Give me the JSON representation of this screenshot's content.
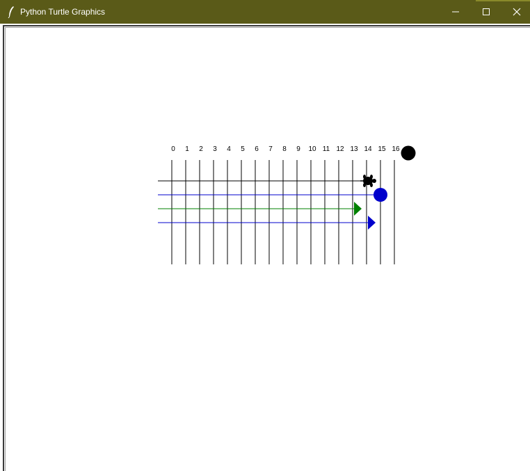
{
  "window": {
    "title": "Python Turtle Graphics",
    "controls": [
      "minimize",
      "maximize",
      "close"
    ],
    "titlebar_color": "#5a5a18"
  },
  "canvas": {
    "background": "#ffffff",
    "column_labels": [
      "0",
      "1",
      "2",
      "3",
      "4",
      "5",
      "6",
      "7",
      "8",
      "9",
      "10",
      "11",
      "12",
      "13",
      "14",
      "15",
      "16"
    ],
    "rows": [
      {
        "color": "#000000",
        "end_marker": "turtle",
        "ends_at_column": 14.5
      },
      {
        "color": "#0000cc",
        "end_marker": "circle",
        "ends_at_column": 15
      },
      {
        "color": "#008000",
        "end_marker": "arrow",
        "ends_at_column": 13.5
      },
      {
        "color": "#0000cc",
        "end_marker": "arrow",
        "ends_at_column": 14.5
      }
    ],
    "top_dot": {
      "color": "#000000",
      "column": 17
    },
    "line_color": "#000000"
  }
}
